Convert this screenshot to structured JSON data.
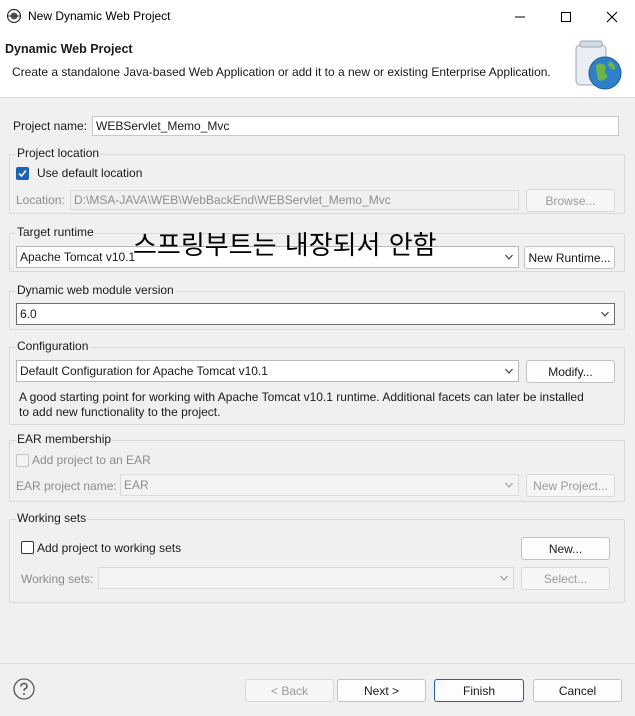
{
  "window": {
    "title": "New Dynamic Web Project",
    "minimize": "minimize",
    "maximize": "maximize",
    "close": "close"
  },
  "banner": {
    "title": "Dynamic Web Project",
    "description": "Create a standalone Java-based Web Application or add it to a new or existing Enterprise Application."
  },
  "project_name": {
    "label": "Project name:",
    "value": "WEBServlet_Memo_Mvc"
  },
  "project_location": {
    "group_title": "Project location",
    "use_default_label": "Use default location",
    "use_default_checked": true,
    "location_label": "Location:",
    "location_value": "D:\\MSA-JAVA\\WEB\\WebBackEnd\\WEBServlet_Memo_Mvc",
    "browse_label": "Browse..."
  },
  "target_runtime": {
    "group_title": "Target runtime",
    "value": "Apache Tomcat v10.1",
    "new_runtime_label": "New Runtime..."
  },
  "overlay_note": "스프링부트는 내장되서 안함",
  "module_version": {
    "group_title": "Dynamic web module version",
    "value": "6.0"
  },
  "configuration": {
    "group_title": "Configuration",
    "value": "Default Configuration for Apache Tomcat v10.1",
    "modify_label": "Modify...",
    "description_line1": "A good starting point for working with Apache Tomcat v10.1 runtime. Additional facets can later be installed",
    "description_line2": "to add new functionality to the project."
  },
  "ear": {
    "group_title": "EAR membership",
    "add_label": "Add project to an EAR",
    "add_checked": false,
    "project_name_label": "EAR project name:",
    "project_name_value": "EAR",
    "new_project_label": "New Project..."
  },
  "working_sets": {
    "group_title": "Working sets",
    "add_label": "Add project to working sets",
    "add_checked": false,
    "new_label": "New...",
    "sets_label": "Working sets:",
    "sets_value": "",
    "select_label": "Select..."
  },
  "footer": {
    "help_icon": "help-icon",
    "back_label": "< Back",
    "next_label": "Next >",
    "finish_label": "Finish",
    "cancel_label": "Cancel"
  }
}
